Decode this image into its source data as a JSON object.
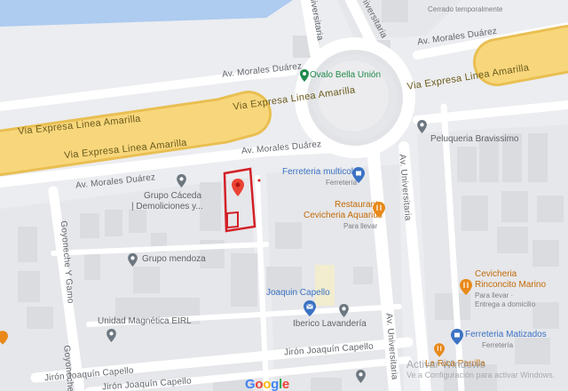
{
  "colors": {
    "background": "#ecedf0",
    "road": "#ffffff",
    "highway": "#f8d77c",
    "highway_edge": "#e9bf52",
    "block": "#dadce0",
    "building": "#e3e5e8",
    "water": "#aecbf0",
    "marker_red": "#ea4335",
    "outline_red": "#d32027",
    "poi_blue": "#3b73c4",
    "poi_orange": "#e8891a",
    "poi_green": "#1f8a4c",
    "poi_gray": "#6d7780"
  },
  "roads": {
    "morales_duarez_1": "Av. Morales Duárez",
    "morales_duarez_2": "Av. Morales Duárez",
    "morales_duarez_3": "Av. Morales Duárez",
    "morales_duarez_4": "Av. Morales Duárez",
    "via_expresa_1": "Via Expresa Linea Amarilla",
    "via_expresa_2": "Via Expresa Linea Amarilla",
    "via_expresa_3": "Via Expresa Linea Amarilla",
    "via_expresa_4": "Via Expresa Linea Amarilla",
    "universitaria_1": "Universitaria",
    "universitaria_2": "Universitaria",
    "universitaria_3": "Av. Universitaria",
    "universitaria_4": "Av. Universitaria",
    "goyoneche_1": "Goyoneche Y Gamo",
    "goyoneche_2": "Goyoneche",
    "capello_1": "Jirón Joaquín Capello",
    "capello_2": "Jirón Joaquín Capello",
    "capello_3": "Jirón Joaquín Capello"
  },
  "places": {
    "ovalo": {
      "name": "Ovalo Bella Unión",
      "icon": "park-pin-icon"
    },
    "cerrado": {
      "sub": "Cerrado temporalmente"
    },
    "peluqueria": {
      "name": "Peluqueria Bravissimo",
      "icon": "place-pin-icon"
    },
    "ferreteria_multicolor": {
      "name": "Ferreteria multicolor",
      "sub": "Ferretería",
      "icon": "shopping-bag-icon"
    },
    "restaurant": {
      "name_line1": "Restaurant",
      "name_line2": "Cevicheria Aquarius",
      "sub": "Para llevar",
      "icon": "restaurant-icon"
    },
    "grupo_caceda": {
      "name_line1": "Grupo Cáceda",
      "name_line2": "| Demoliciones y...",
      "icon": "place-pin-icon"
    },
    "grupo_mendoza": {
      "name": "Grupo mendoza",
      "icon": "place-pin-icon"
    },
    "joaquin_capello": {
      "name": "Joaquin Capello",
      "icon": "mail-icon"
    },
    "ibérico": {
      "name": "Iberico Lavandería",
      "icon": "place-pin-icon"
    },
    "unidad_magnetica": {
      "name": "Unidad Magnética EIRL",
      "icon": "place-pin-icon"
    },
    "cevicheria_rinconcito": {
      "name_line1": "Cevicheria",
      "name_line2": "Rinconcito Marino",
      "sub_line1": "Para llevar ·",
      "sub_line2": "Entrega a domicilio",
      "icon": "restaurant-icon"
    },
    "ferreteria_matizados": {
      "name": "Ferreteria Matizados",
      "sub": "Ferretería",
      "icon": "shopping-bag-icon"
    },
    "la_rica_parrilla": {
      "name": "La Rica Parrilla",
      "icon": "restaurant-icon"
    }
  },
  "logo": {
    "g1": "G",
    "o1": "o",
    "o2": "o",
    "g2": "g",
    "l": "l",
    "e": "e"
  },
  "watermark": {
    "title": "Activar Windows",
    "sub": "Ve a Configuración para activar Windows."
  }
}
